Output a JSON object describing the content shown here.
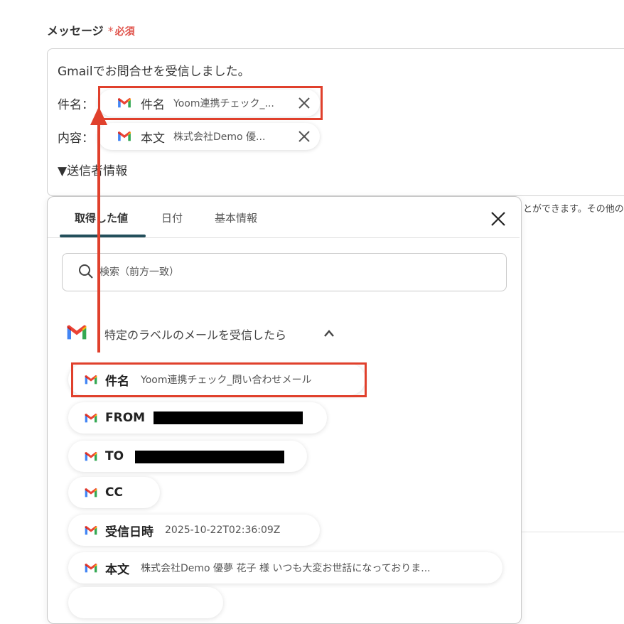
{
  "field": {
    "label": "メッセージ",
    "required_star": "*",
    "required_text": "必須"
  },
  "editor": {
    "line1": "Gmailでお問合せを受信しました。",
    "subject_prefix": "件名：",
    "body_prefix": "内容：",
    "sender_line": "▼送信者情報",
    "chip_subject": {
      "label": "件名",
      "value": "Yoom連携チェック_..."
    },
    "chip_body": {
      "label": "本文",
      "value": "株式会社Demo 優..."
    }
  },
  "hint_text": "とができます。その他の",
  "panel": {
    "tabs": [
      "取得した値",
      "日付",
      "基本情報"
    ],
    "active_tab": 0,
    "search_placeholder": "検索（前方一致）",
    "group_title": "特定のラベルのメールを受信したら",
    "items": [
      {
        "label": "件名",
        "value": "Yoom連携チェック_問い合わせメール"
      },
      {
        "label": "FROM",
        "value": ""
      },
      {
        "label": "TO",
        "value": ""
      },
      {
        "label": "CC",
        "value": ""
      },
      {
        "label": "受信日時",
        "value": "2025-10-22T02:36:09Z"
      },
      {
        "label": "本文",
        "value": "株式会社Demo 優夢 花子 様 いつも大変お世話になっておりま..."
      }
    ]
  },
  "colors": {
    "required": "#e0544c",
    "highlight": "#e0402c",
    "tab_underline": "#234f5b"
  },
  "icons": [
    "gmail-icon",
    "close-icon",
    "search-icon",
    "chevron-up-icon"
  ]
}
